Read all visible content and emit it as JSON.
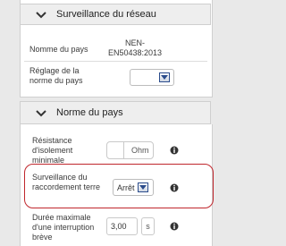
{
  "network_panel": {
    "title": "Surveillance du réseau",
    "country_name_label": "Nomme du pays",
    "country_name_value": "NEN-EN50438:2013",
    "country_setting_label": "Réglage de la norme du pays"
  },
  "country_panel": {
    "title": "Norme du pays",
    "insulation_label": "Résistance d'isolement minimale",
    "insulation_unit": "Ohm",
    "earth_label": "Surveillance du raccordement terre",
    "earth_value": "Arrêt",
    "max_interrupt_label": "Durée maximale d'une interruption brève",
    "max_interrupt_value": "3,00",
    "max_interrupt_unit": "s"
  },
  "colors": {
    "highlight": "#c0272d",
    "dropdown_arrow": "#2b4c8c"
  },
  "icons": [
    "chevron-down-icon",
    "info-icon",
    "dropdown-arrow-icon"
  ]
}
